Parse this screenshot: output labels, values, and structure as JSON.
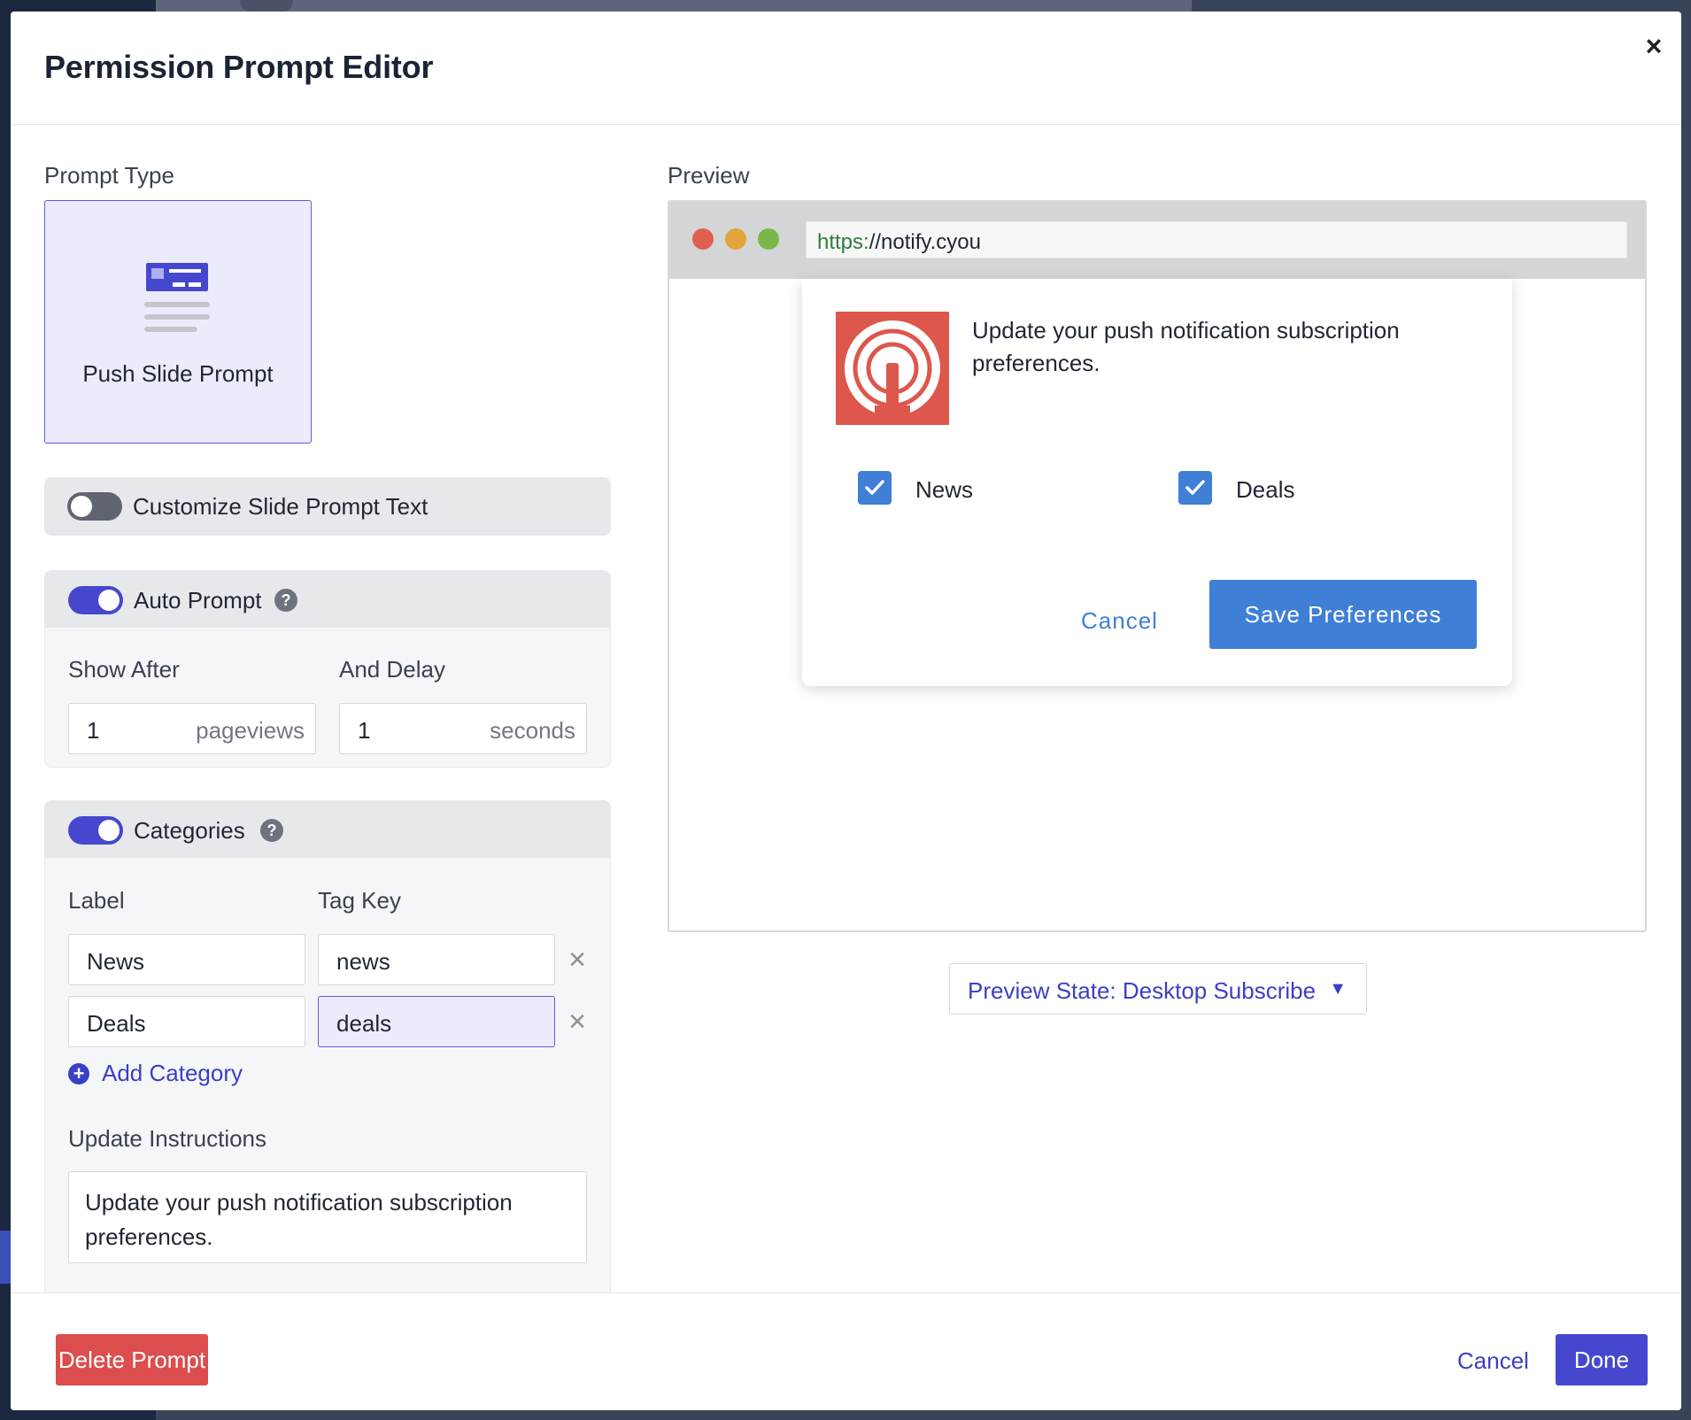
{
  "modal": {
    "title": "Permission Prompt Editor",
    "close_label": "×"
  },
  "prompt_type": {
    "section_label": "Prompt Type",
    "selected_card_label": "Push Slide Prompt"
  },
  "customize_text": {
    "label": "Customize Slide Prompt Text",
    "enabled": false
  },
  "auto_prompt": {
    "label": "Auto Prompt",
    "enabled": true,
    "help": "?",
    "show_after_label": "Show After",
    "show_after_value": "1",
    "show_after_unit": "pageviews",
    "delay_label": "And Delay",
    "delay_value": "1",
    "delay_unit": "seconds"
  },
  "categories": {
    "label": "Categories",
    "enabled": true,
    "help": "?",
    "label_col": "Label",
    "tag_col": "Tag Key",
    "rows": [
      {
        "label": "News",
        "tag": "news"
      },
      {
        "label": "Deals",
        "tag": "deals"
      }
    ],
    "remove_label": "×",
    "add_label": "Add Category",
    "add_icon": "+",
    "instructions_label": "Update Instructions",
    "instructions_value": "Update your push notification subscription preferences."
  },
  "preview": {
    "section_label": "Preview",
    "url_scheme": "https:",
    "url_rest": "//notify.cyou",
    "message": "Update your push notification subscription preferences.",
    "options": [
      "News",
      "Deals"
    ],
    "cancel_label": "Cancel",
    "save_label": "Save Preferences",
    "state_label": "Preview State: Desktop Subscribe",
    "state_caret": "▼"
  },
  "footer": {
    "delete_label": "Delete Prompt",
    "cancel_label": "Cancel",
    "done_label": "Done"
  },
  "colors": {
    "primary": "#4548cf",
    "preview_blue": "#3f7fd6",
    "danger": "#dc4d4d",
    "logo_red": "#dd574c"
  }
}
